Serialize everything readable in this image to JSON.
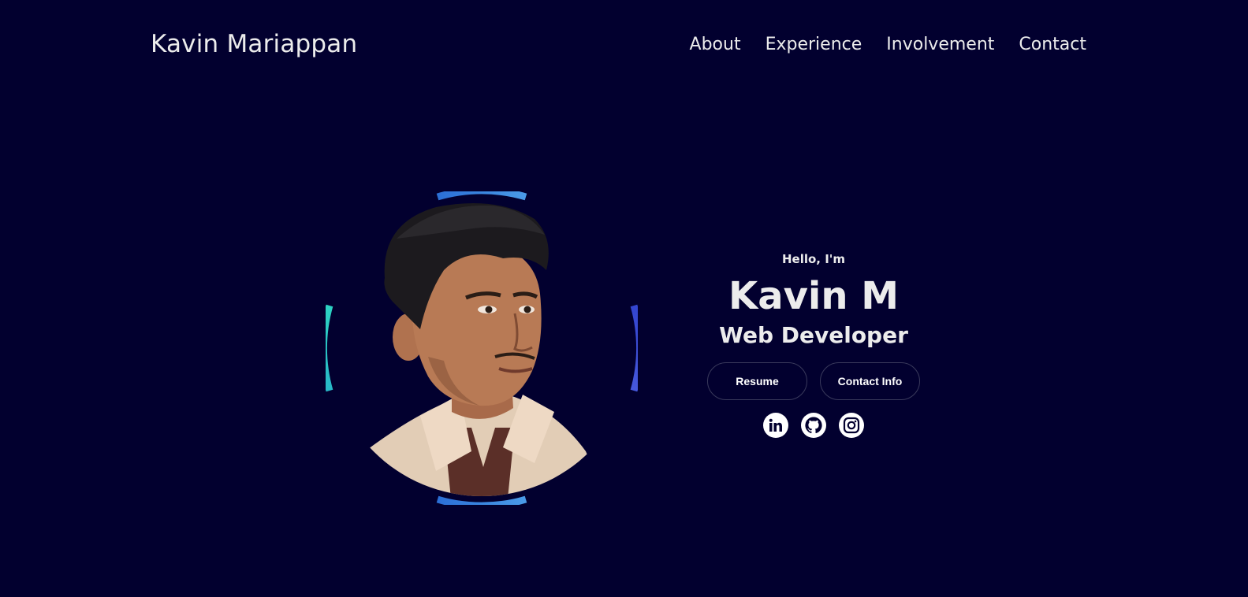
{
  "header": {
    "logo": "Kavin Mariappan",
    "nav": [
      {
        "label": "About"
      },
      {
        "label": "Experience"
      },
      {
        "label": "Involvement"
      },
      {
        "label": "Contact"
      }
    ]
  },
  "hero": {
    "greeting": "Hello, I'm",
    "name": "Kavin M",
    "role": "Web Developer",
    "buttons": {
      "resume": "Resume",
      "contact": "Contact Info"
    },
    "socials": [
      {
        "icon": "linkedin-icon"
      },
      {
        "icon": "github-icon"
      },
      {
        "icon": "instagram-icon"
      }
    ]
  },
  "colors": {
    "background": "#02002f",
    "text": "#ececec",
    "ring_left": "#2bc4c4",
    "ring_top": "#3a8fe0",
    "ring_right": "#3d4fd8"
  }
}
